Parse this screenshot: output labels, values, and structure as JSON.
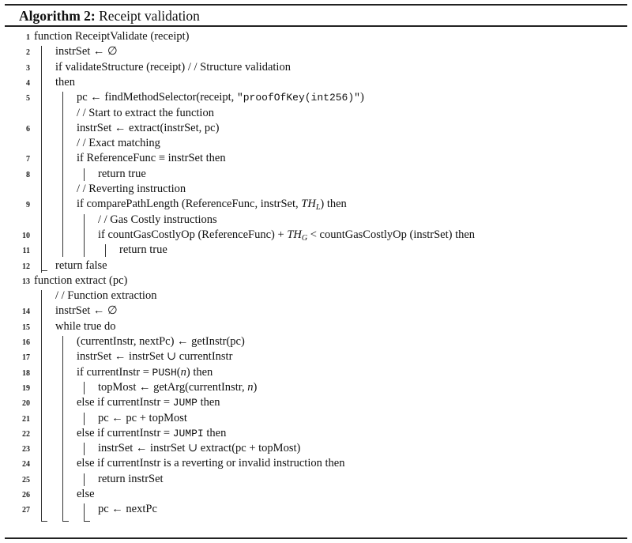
{
  "algorithm": {
    "label": "Algorithm 2:",
    "title": "Receipt validation"
  },
  "lines": [
    {
      "num": "1",
      "level": 0,
      "text": "function ReceiptValidate (receipt)"
    },
    {
      "num": "2",
      "level": 1,
      "text": "instrSet ← ∅"
    },
    {
      "num": "3",
      "level": 1,
      "text": "if validateStructure (receipt) / / Structure validation"
    },
    {
      "num": "4",
      "level": 1,
      "text": " then"
    },
    {
      "num": "5",
      "level": 2,
      "parts": [
        {
          "t": "pc ← findMethodSelector(receipt, "
        },
        {
          "t": "\"proofOfKey(int256)\"",
          "style": "mono"
        },
        {
          "t": ")"
        }
      ]
    },
    {
      "num": "",
      "level": 2,
      "text": "/ / Start to extract the function"
    },
    {
      "num": "6",
      "level": 2,
      "text": "instrSet ← extract(instrSet, pc)"
    },
    {
      "num": "",
      "level": 2,
      "text": "/ / Exact matching"
    },
    {
      "num": "7",
      "level": 2,
      "text": "if ReferenceFunc ≡ instrSet then"
    },
    {
      "num": "8",
      "level": 3,
      "text": "return true"
    },
    {
      "num": "",
      "level": 2,
      "text": "/ / Reverting instruction"
    },
    {
      "num": "9",
      "level": 2,
      "parts": [
        {
          "t": "if  comparePathLength (ReferenceFunc, instrSet, "
        },
        {
          "t": "TH",
          "style": "math"
        },
        {
          "t": "L",
          "style": "sub"
        },
        {
          "t": ") then"
        }
      ]
    },
    {
      "num": "",
      "level": 3,
      "text": "/ / Gas Costly instructions"
    },
    {
      "num": "10",
      "level": 3,
      "parts": [
        {
          "t": "if countGasCostlyOp (ReferenceFunc) + "
        },
        {
          "t": "TH",
          "style": "math"
        },
        {
          "t": "G",
          "style": "sub"
        },
        {
          "t": " < countGasCostlyOp (instrSet) then"
        }
      ]
    },
    {
      "num": "11",
      "level": 4,
      "text": "return true"
    },
    {
      "num": "12",
      "level": 1,
      "text": "return false"
    },
    {
      "num": "13",
      "level": 0,
      "text": "function extract (pc)"
    },
    {
      "num": "",
      "level": 1,
      "text": "/ / Function extraction"
    },
    {
      "num": "14",
      "level": 1,
      "text": "instrSet ← ∅"
    },
    {
      "num": "15",
      "level": 1,
      "text": "while true do"
    },
    {
      "num": "16",
      "level": 2,
      "text": "(currentInstr, nextPc) ← getInstr(pc)"
    },
    {
      "num": "17",
      "level": 2,
      "text": "instrSet ← instrSet ∪ currentInstr"
    },
    {
      "num": "18",
      "level": 2,
      "parts": [
        {
          "t": "if currentInstr = "
        },
        {
          "t": "PUSH",
          "style": "mono"
        },
        {
          "t": "("
        },
        {
          "t": "n",
          "style": "math"
        },
        {
          "t": ") then"
        }
      ]
    },
    {
      "num": "19",
      "level": 3,
      "parts": [
        {
          "t": "topMost ← getArg(currentInstr, "
        },
        {
          "t": "n",
          "style": "math"
        },
        {
          "t": ")"
        }
      ]
    },
    {
      "num": "20",
      "level": 2,
      "parts": [
        {
          "t": "else if currentInstr = "
        },
        {
          "t": "JUMP",
          "style": "mono"
        },
        {
          "t": " then"
        }
      ]
    },
    {
      "num": "21",
      "level": 3,
      "text": "pc ← pc + topMost"
    },
    {
      "num": "22",
      "level": 2,
      "parts": [
        {
          "t": "else if currentInstr = "
        },
        {
          "t": "JUMPI",
          "style": "mono"
        },
        {
          "t": " then"
        }
      ]
    },
    {
      "num": "23",
      "level": 3,
      "text": "instrSet ← instrSet ∪ extract(pc + topMost)"
    },
    {
      "num": "24",
      "level": 2,
      "text": "else if currentInstr is a reverting or invalid instruction then"
    },
    {
      "num": "25",
      "level": 3,
      "text": "return instrSet"
    },
    {
      "num": "26",
      "level": 2,
      "text": "else"
    },
    {
      "num": "27",
      "level": 3,
      "text": "pc ← nextPc"
    }
  ]
}
